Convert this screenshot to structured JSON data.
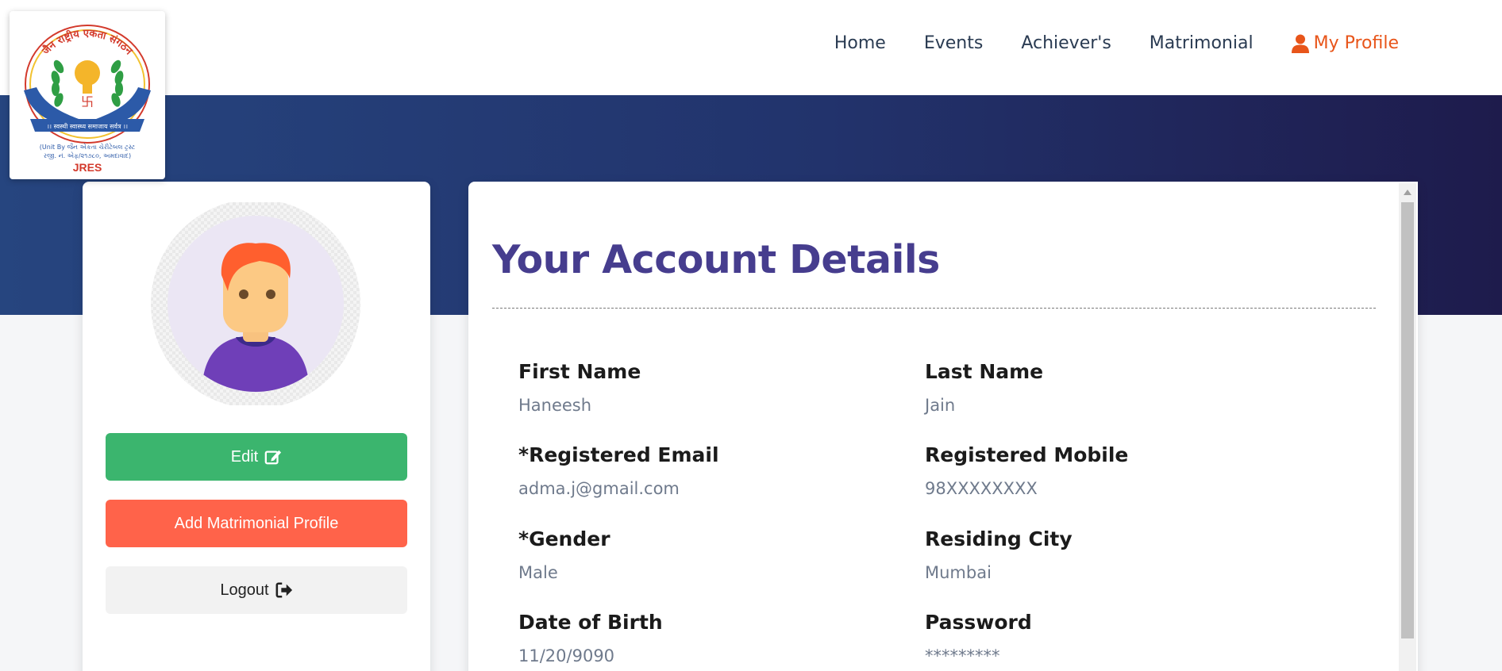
{
  "header": {
    "logo": {
      "arc_text": "जैन राष्ट्रीय एकता संगठन",
      "ribbon_text": "।। स्वस्थी स्वास्थ्य समाजाय सर्वत्र ।।",
      "unit_line1": "(Unit By જૈન એકતા ચેરીટેબલ ટ્રસ્ટ",
      "unit_line2": "રજી. નં. એફ/૨૧૭૮૦, અમદાવાદ)",
      "abbr": "JRES"
    },
    "nav": {
      "home": "Home",
      "events": "Events",
      "achievers": "Achiever's",
      "matrimonial": "Matrimonial",
      "my_profile": "My Profile"
    }
  },
  "sidebar": {
    "edit_label": "Edit",
    "add_matrimonial_label": "Add Matrimonial Profile",
    "logout_label": "Logout"
  },
  "account": {
    "title": "Your Account Details",
    "fields": [
      {
        "label": "First Name",
        "value": "Haneesh"
      },
      {
        "label": "Last Name",
        "value": "Jain"
      },
      {
        "label": "*Registered Email",
        "value": "adma.j@gmail.com"
      },
      {
        "label": "Registered Mobile",
        "value": "98XXXXXXXX"
      },
      {
        "label": "*Gender",
        "value": "Male"
      },
      {
        "label": "Residing City",
        "value": "Mumbai"
      },
      {
        "label": "Date of Birth",
        "value": "11/20/9090"
      },
      {
        "label": "Password",
        "value": "*********"
      }
    ]
  },
  "colors": {
    "accent_orange": "#e8551a",
    "edit_green": "#3bb56e",
    "matrimonial_red": "#ff634a",
    "title_purple": "#463d8e",
    "banner_start": "#26457f",
    "banner_end": "#1e1b4c"
  },
  "icons": {
    "profile": "user-icon",
    "edit": "edit-icon",
    "logout": "sign-out-icon",
    "scroll_up": "chevron-up-icon"
  }
}
